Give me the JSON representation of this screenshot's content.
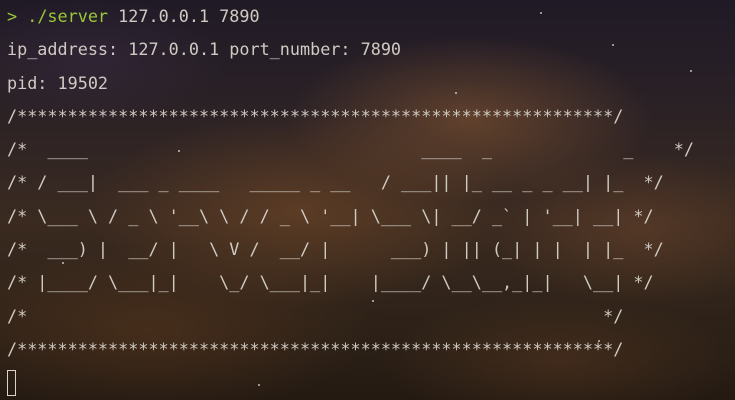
{
  "prompt": {
    "arrow": ">",
    "command": " ./server",
    "args": " 127.0.0.1 7890"
  },
  "output": {
    "ip_line": "ip_address: 127.0.0.1 port_number: 7890",
    "pid_line": "pid: 19502"
  },
  "banner": [
    "/***********************************************************/",
    "/*  ____                                 ____  _             _    */",
    "/* / ___|  ___ _ ____   _____ _ __   / ___|| |_ __ _ _ __| |_  */",
    "/* \\___ \\ / _ \\ '__\\ \\ / / _ \\ '__| \\___ \\| __/ _` | '__| __| */",
    "/*  ___) |  __/ |   \\ V /  __/ |      ___) | || (_| | |  | |_  */",
    "/* |____/ \\___|_|    \\_/ \\___|_|    |____/ \\__\\__,_|_|   \\__| */",
    "/*                                                         */",
    "/***********************************************************/"
  ]
}
